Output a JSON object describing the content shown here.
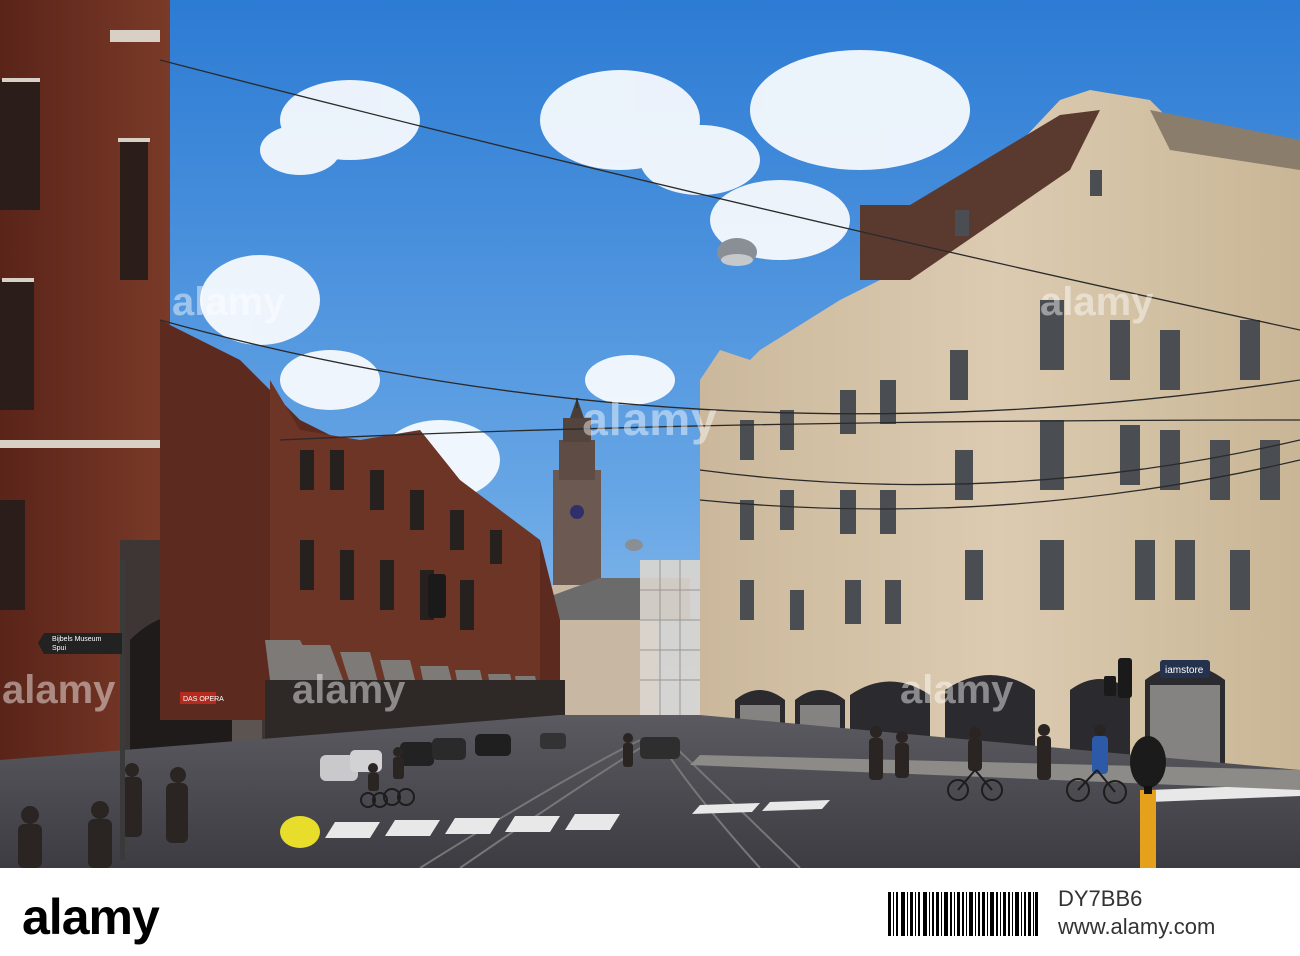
{
  "scene": {
    "description_colors": {
      "sky_top": "#2f7fd6",
      "sky_bottom": "#a9cdee",
      "brick": "#6e2f22",
      "stone": "#d9c8ae",
      "road": "#4a4a4f"
    }
  },
  "street_sign": {
    "line1": "Bijbels Museum",
    "line2": "Spui"
  },
  "shop_sign": {
    "text": "iamstore"
  },
  "awning_sign": {
    "text": "DAS OPERA"
  },
  "watermark": {
    "text": "alamy"
  },
  "footer": {
    "logo": "alamy",
    "image_id": "DY7BB6",
    "url": "www.alamy.com"
  }
}
